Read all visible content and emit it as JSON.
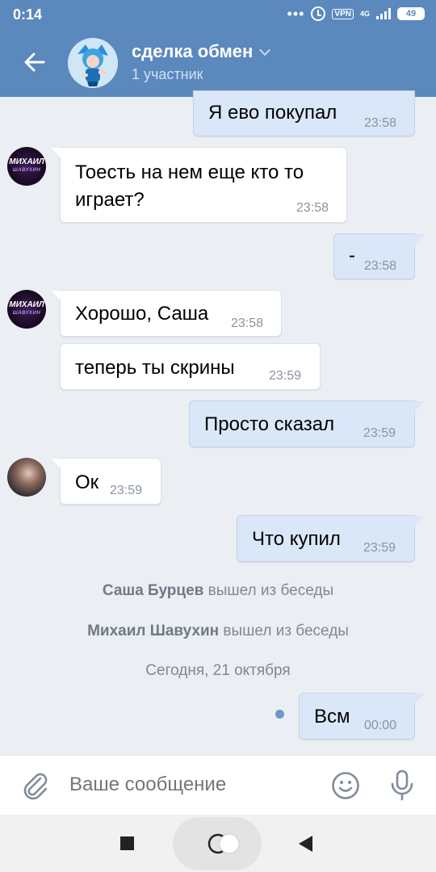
{
  "status_bar": {
    "time": "0:14",
    "vpn": "VPN",
    "network": "4G",
    "battery": "49"
  },
  "header": {
    "title": "сделка обмен",
    "subtitle": "1 участник"
  },
  "messages": [
    {
      "side": "out",
      "text": "Я ево покупал",
      "time": "23:58"
    },
    {
      "side": "in",
      "author_avatar": "МИХАИЛ",
      "text_line1": "Тоесть на нем еще кто то",
      "text_line2": "играет?",
      "time": "23:58"
    },
    {
      "side": "out",
      "text": "-",
      "time": "23:58"
    },
    {
      "side": "in",
      "author_avatar": "МИХАИЛ",
      "text": "Хорошо, Саша",
      "time": "23:58"
    },
    {
      "side": "in",
      "text": "теперь ты скрины",
      "time": "23:59"
    },
    {
      "side": "out",
      "text": "Просто сказал",
      "time": "23:59"
    },
    {
      "side": "in",
      "text": "Ок",
      "time": "23:59"
    },
    {
      "side": "out",
      "text": "Что купил",
      "time": "23:59"
    },
    {
      "side": "out",
      "text": "Всм",
      "time": "00:00"
    }
  ],
  "avatar_text": {
    "line1": "МИХАИЛ",
    "line2": "ШАВУХИН"
  },
  "system": [
    {
      "name": "Саша Бурцев",
      "action": "вышел из беседы"
    },
    {
      "name": "Михаил Шавухин",
      "action": "вышел из беседы"
    },
    {
      "date": "Сегодня, 21 октября"
    }
  ],
  "composer": {
    "placeholder": "Ваше сообщение"
  },
  "icons": {
    "back": "arrow-left-icon",
    "attach": "paperclip-icon",
    "emoji": "smile-icon",
    "voice": "microphone-icon"
  }
}
